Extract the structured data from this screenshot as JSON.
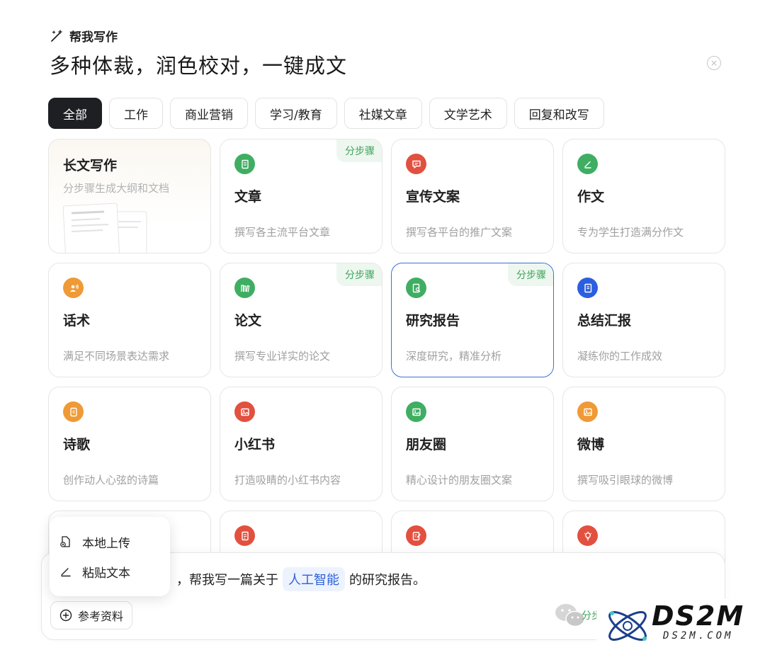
{
  "header": {
    "tag": "帮我写作",
    "title": "多种体裁，润色校对，一键成文",
    "close": "×"
  },
  "tabs": [
    "全部",
    "工作",
    "商业营销",
    "学习/教育",
    "社媒文章",
    "文学艺术",
    "回复和改写"
  ],
  "step_badge": "分步骤",
  "longform": {
    "title": "长文写作",
    "desc": "分步骤生成大纲和文档"
  },
  "cards": [
    {
      "title": "文章",
      "desc": "撰写各主流平台文章",
      "color": "#3fae62",
      "icon": "article-icon",
      "step": true
    },
    {
      "title": "宣传文案",
      "desc": "撰写各平台的推广文案",
      "color": "#e2503f",
      "icon": "chat-bubble-icon",
      "step": false
    },
    {
      "title": "作文",
      "desc": "专为学生打造满分作文",
      "color": "#3fae62",
      "icon": "pen-icon",
      "step": false
    },
    {
      "title": "话术",
      "desc": "满足不同场景表达需求",
      "color": "#ef9a36",
      "icon": "speaker-icon",
      "step": false
    },
    {
      "title": "论文",
      "desc": "撰写专业详实的论文",
      "color": "#3fae62",
      "icon": "books-icon",
      "step": true
    },
    {
      "title": "研究报告",
      "desc": "深度研究，精准分析",
      "color": "#3fae62",
      "icon": "doc-search-icon",
      "step": true,
      "selected": true
    },
    {
      "title": "总结汇报",
      "desc": "凝练你的工作成效",
      "color": "#2c5fe0",
      "icon": "notebook-icon",
      "step": false
    },
    {
      "title": "诗歌",
      "desc": "创作动人心弦的诗篇",
      "color": "#ef9a36",
      "icon": "poem-icon",
      "step": false
    },
    {
      "title": "小红书",
      "desc": "打造吸睛的小红书内容",
      "color": "#e2503f",
      "icon": "image-icon",
      "step": false
    },
    {
      "title": "朋友圈",
      "desc": "精心设计的朋友圈文案",
      "color": "#3fae62",
      "icon": "image-icon",
      "step": false
    },
    {
      "title": "微博",
      "desc": "撰写吸引眼球的微博",
      "color": "#ef9a36",
      "icon": "image-icon",
      "step": false
    },
    {
      "title": "",
      "desc": "",
      "color": "#ef9a36",
      "icon": "",
      "step": false
    },
    {
      "title": "",
      "desc": "",
      "color": "#e2503f",
      "icon": "note-icon",
      "step": false
    },
    {
      "title": "",
      "desc": "",
      "color": "#e2503f",
      "icon": "edit-doc-icon",
      "step": false
    },
    {
      "title": "",
      "desc": "",
      "color": "#e2503f",
      "icon": "lightbulb-icon",
      "step": false
    }
  ],
  "composer": {
    "prompt_before": "，帮我写一篇关于",
    "topic": "人工智能",
    "prompt_after": "的研究报告。",
    "reference_label": "参考资料",
    "step_partial": "分步"
  },
  "popup": {
    "upload": "本地上传",
    "paste": "粘贴文本"
  },
  "watermark": {
    "main": "DS2M",
    "sub": "DS2M.COM"
  }
}
